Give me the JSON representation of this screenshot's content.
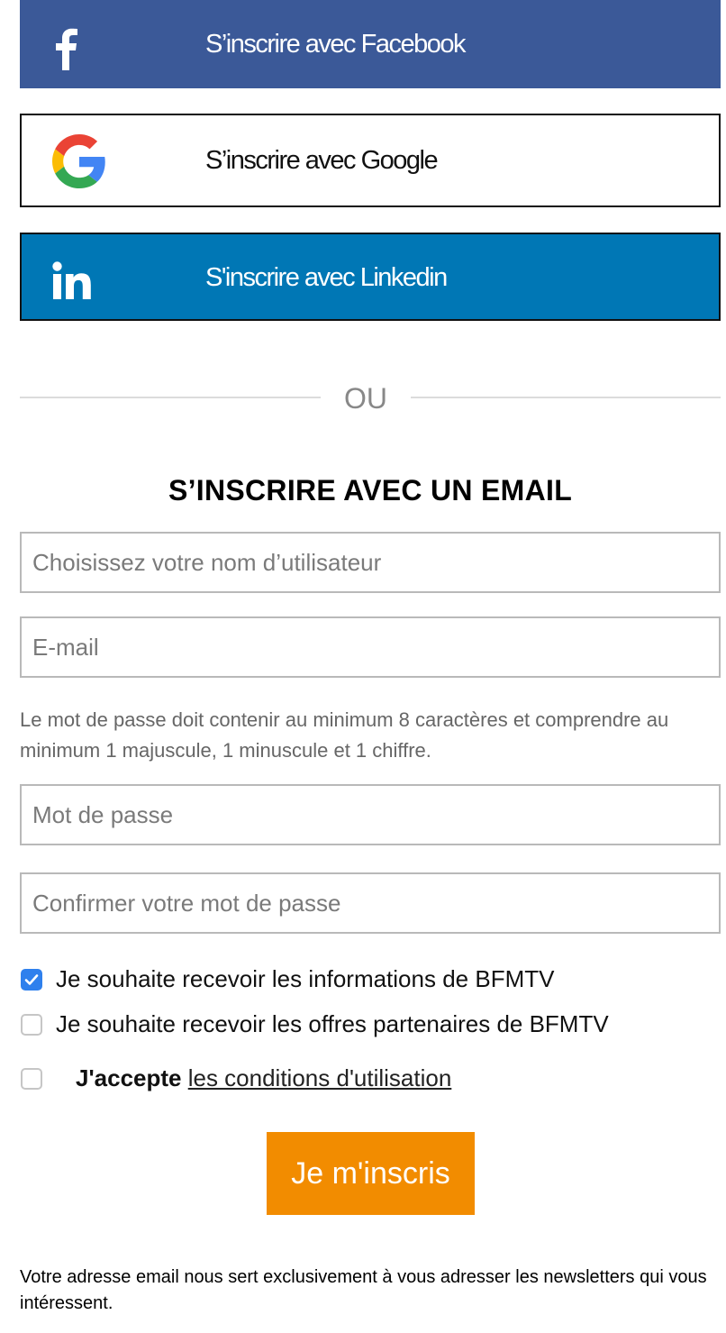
{
  "social": {
    "facebook_label": "S’inscrire avec Facebook",
    "google_label": "S’inscrire avec Google",
    "linkedin_label": "S'inscrire avec Linkedin",
    "facebook_color": "#3b5998",
    "linkedin_color": "#0077b5"
  },
  "divider": {
    "text": "OU"
  },
  "form": {
    "title": "S’INSCRIRE AVEC UN EMAIL",
    "username_placeholder": "Choisissez votre nom d’utilisateur",
    "email_placeholder": "E-mail",
    "password_hint": "Le mot de passe doit contenir au minimum 8 caractères et comprendre au minimum 1 majuscule, 1 minuscule et 1 chiffre.",
    "password_placeholder": "Mot de passe",
    "confirm_placeholder": "Confirmer votre mot de passe",
    "newsletter_label": "Je souhaite recevoir les informations de BFMTV",
    "newsletter_checked": true,
    "partners_label": "Je souhaite recevoir les offres partenaires de BFMTV",
    "partners_checked": false,
    "accept_bold": "J'accepte",
    "accept_link": "les conditions d'utilisation",
    "accept_checked": false,
    "submit_label": "Je m'inscris",
    "submit_color": "#f28c00"
  },
  "footer": {
    "text": "Votre adresse email nous sert exclusivement à vous adresser les newsletters qui vous intéressent."
  }
}
